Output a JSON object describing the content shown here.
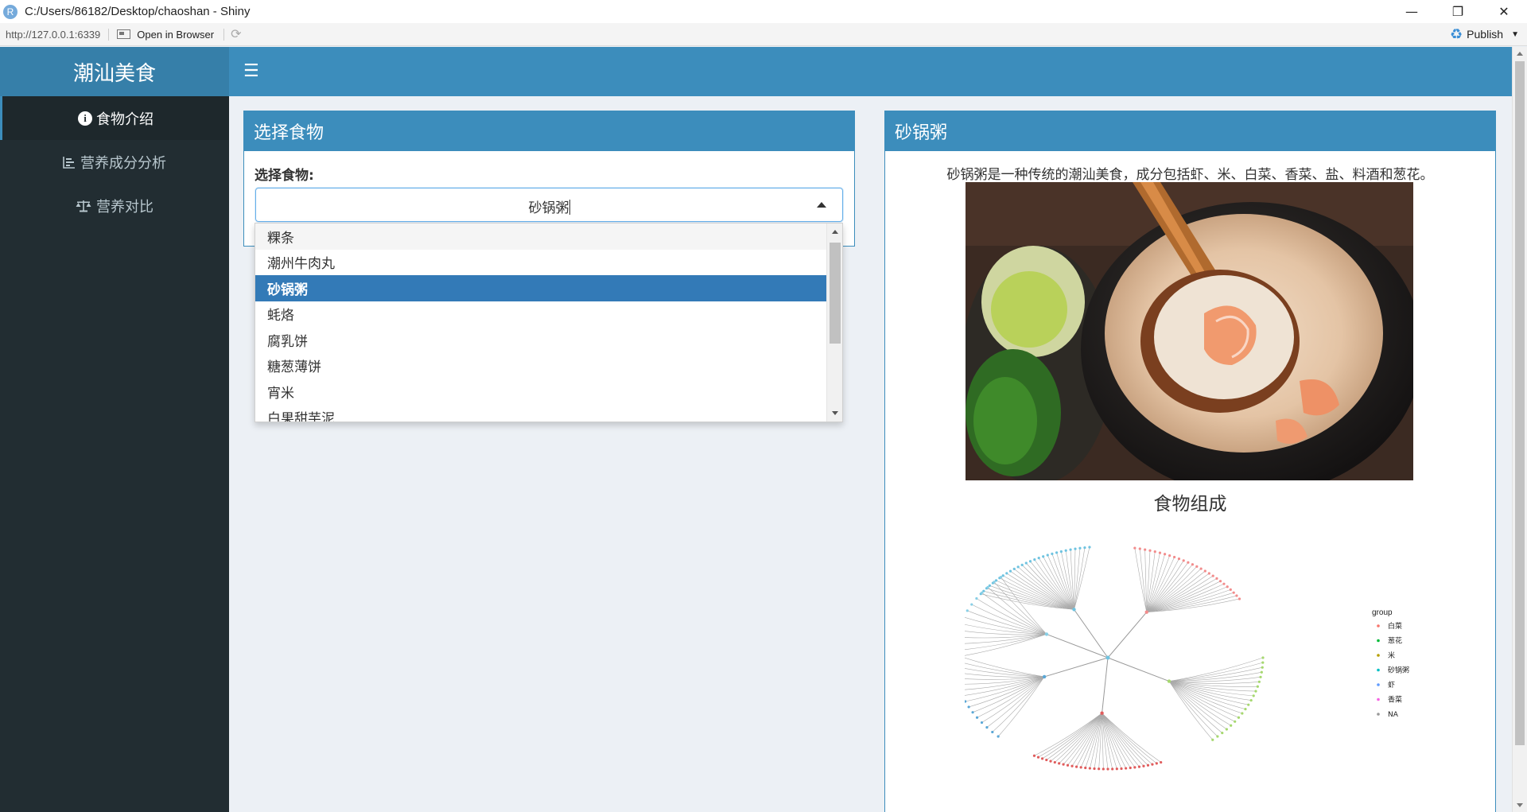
{
  "window": {
    "title": "C:/Users/86182/Desktop/chaoshan - Shiny",
    "minimize_icon": "minimize-icon",
    "maximize_icon": "restore-icon",
    "close_icon": "close-icon"
  },
  "toolbar": {
    "url": "http://127.0.0.1:6339",
    "open_in_browser": "Open in Browser",
    "publish": "Publish"
  },
  "header": {
    "brand": "潮汕美食"
  },
  "sidebar": {
    "items": [
      {
        "label": "食物介绍",
        "icon": "info-circle-icon",
        "active": true
      },
      {
        "label": "营养成分分析",
        "icon": "bar-chart-icon",
        "active": false
      },
      {
        "label": "营养对比",
        "icon": "balance-scale-icon",
        "active": false
      }
    ]
  },
  "select_box": {
    "title": "选择食物",
    "label": "选择食物:",
    "value": "砂锅粥",
    "options": [
      "粿条",
      "潮州牛肉丸",
      "砂锅粥",
      "蚝烙",
      "腐乳饼",
      "糖葱薄饼",
      "宵米",
      "白果甜芋泥"
    ],
    "hover_index": 0,
    "selected_index": 2
  },
  "food_panel": {
    "title": "砂锅粥",
    "description": "砂锅粥是一种传统的潮汕美食，成分包括虾、米、白菜、香菜、盐、料酒和葱花。",
    "chart_title": "食物组成",
    "legend_title": "group",
    "legend": [
      {
        "label": "白菜",
        "color": "#f8766d"
      },
      {
        "label": "葱花",
        "color": "#00ba38"
      },
      {
        "label": "米",
        "color": "#b79f00"
      },
      {
        "label": "砂锅粥",
        "color": "#00bfc4"
      },
      {
        "label": "虾",
        "color": "#619cff"
      },
      {
        "label": "香菜",
        "color": "#f564e3"
      },
      {
        "label": "NA",
        "color": "#999999"
      }
    ]
  }
}
